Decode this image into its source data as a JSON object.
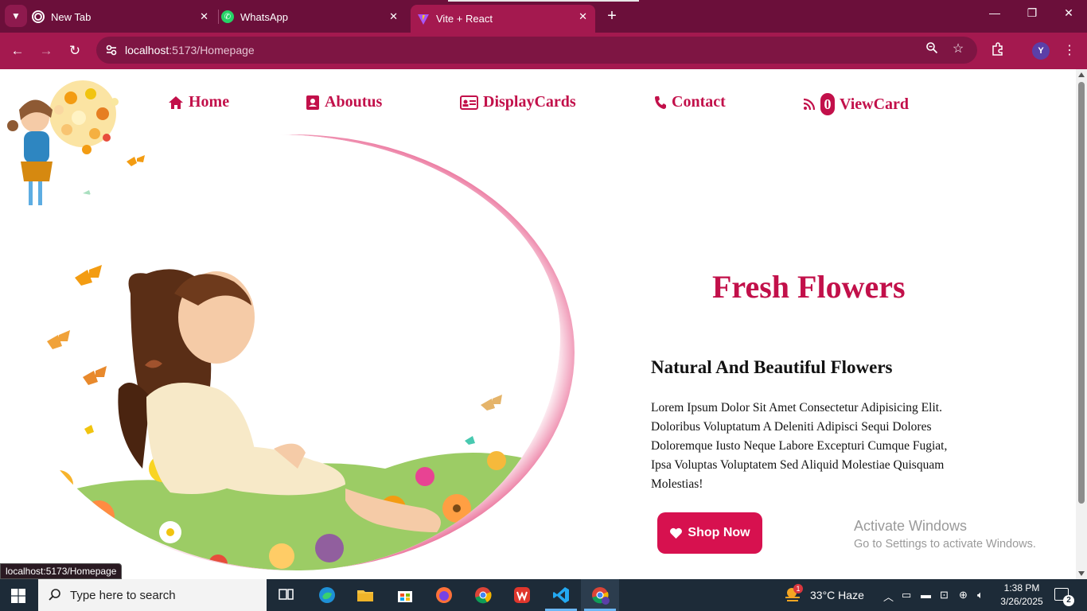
{
  "browser": {
    "tabs": [
      {
        "title": "New Tab",
        "icon": "chrome-icon"
      },
      {
        "title": "WhatsApp",
        "icon": "whatsapp-icon"
      },
      {
        "title": "Vite + React",
        "icon": "vite-icon",
        "active": true
      }
    ],
    "url_host": "localhost",
    "url_path": ":5173/Homepage",
    "profile_initial": "Y"
  },
  "nav": {
    "items": [
      {
        "label": "Home",
        "icon": "home-icon"
      },
      {
        "label": "Aboutus",
        "icon": "user-card-icon"
      },
      {
        "label": "DisplayCards",
        "icon": "id-card-icon"
      },
      {
        "label": "Contact",
        "icon": "phone-icon"
      },
      {
        "label": "ViewCard",
        "icon": "rss-icon",
        "badge": "0"
      }
    ]
  },
  "hero": {
    "title": "Fresh Flowers",
    "subtitle": "Natural And Beautiful Flowers",
    "description": "Lorem Ipsum Dolor Sit Amet Consectetur Adipisicing Elit. Doloribus Voluptatum A Deleniti Adipisci Sequi Dolores Doloremque Iusto Neque Labore Excepturi Cumque Fugiat, Ipsa Voluptas Voluptatem Sed Aliquid Molestiae Quisquam Molestias!",
    "button_label": "Shop Now"
  },
  "watermark": {
    "line1": "Activate Windows",
    "line2": "Go to Settings to activate Windows."
  },
  "status_bar": {
    "url": "localhost:5173/Homepage"
  },
  "taskbar": {
    "search_placeholder": "Type here to search",
    "weather": "33°C  Haze",
    "weather_badge": "1",
    "time": "1:38 PM",
    "date": "3/26/2025",
    "notifications": "2"
  },
  "colors": {
    "accent": "#c2104a",
    "chrome_dark": "#6b0f3a",
    "chrome": "#a4194f"
  }
}
